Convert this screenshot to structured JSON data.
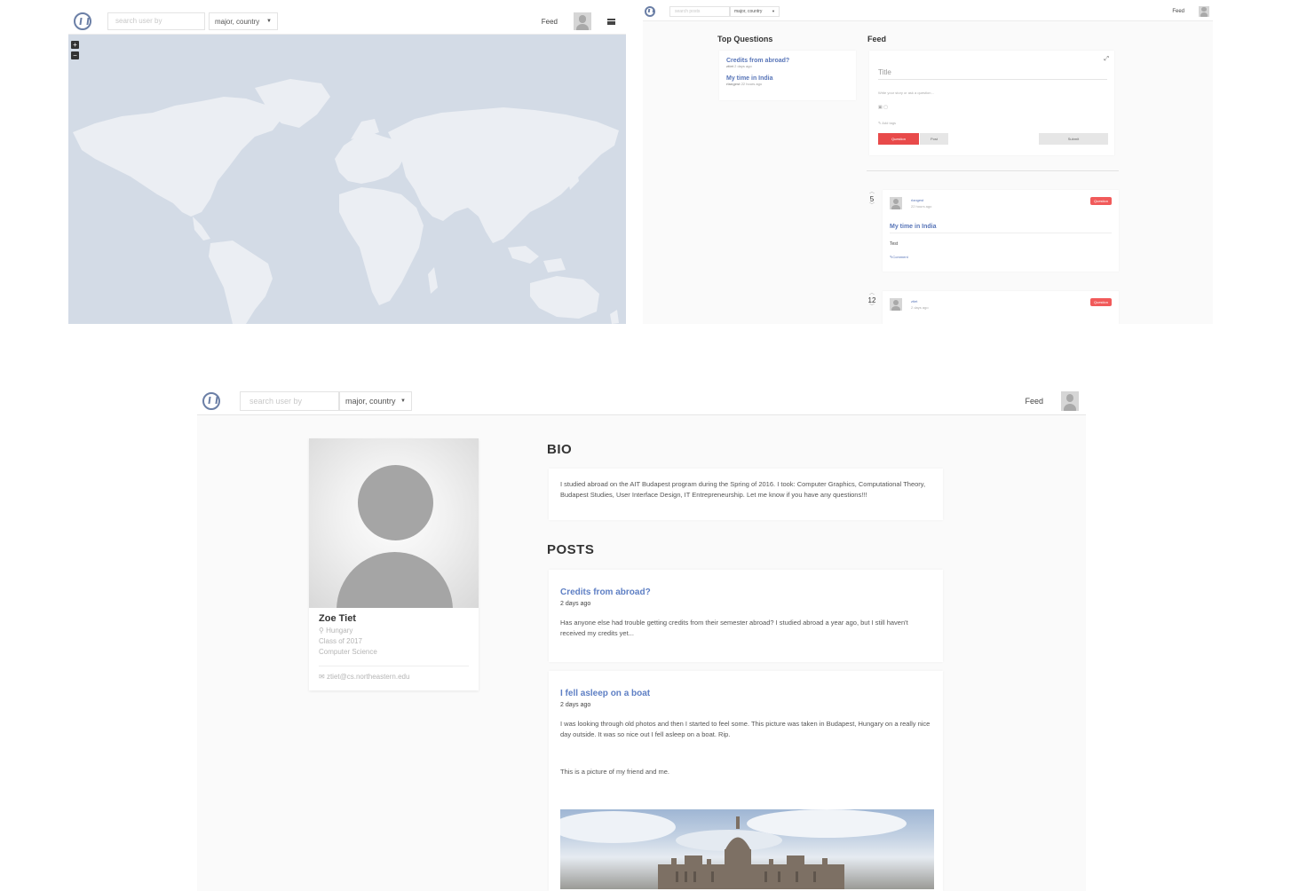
{
  "map_screen": {
    "search_placeholder": "search user by",
    "filter_value": "major, country",
    "feed_link": "Feed",
    "zoom_in": "+",
    "zoom_out": "−"
  },
  "feed_screen": {
    "search_placeholder": "search posts",
    "filter_value": "major, country",
    "feed_link": "Feed",
    "top_questions_heading": "Top Questions",
    "feed_heading": "Feed",
    "top_questions": [
      {
        "title": "Credits from abroad?",
        "author": "ztiet",
        "time": "2 days ago"
      },
      {
        "title": "My time in India",
        "author": "rlangest",
        "time": "22 hours ago"
      }
    ],
    "composer": {
      "title_placeholder": "Title",
      "body_placeholder": "Write your story or ask a question...",
      "tag_placeholder": "Add tags",
      "question_button": "Question",
      "post_button": "Post",
      "submit_button": "Submit"
    },
    "posts": [
      {
        "votes": "5",
        "author": "rlangest",
        "time": "22 hours ago",
        "tag": "Question",
        "title": "My time in India",
        "body": "Test",
        "comment": "Comment"
      },
      {
        "votes": "12",
        "author": "ztiet",
        "time": "2 days ago",
        "tag": "Question"
      }
    ]
  },
  "profile_screen": {
    "search_placeholder": "search user by",
    "filter_value": "major, country",
    "feed_link": "Feed",
    "name": "Zoe Tiet",
    "country": "Hungary",
    "class_year": "Class of 2017",
    "major": "Computer Science",
    "email": "ztiet@cs.northeastern.edu",
    "bio_heading": "BIO",
    "bio_text": "I studied abroad on the AIT Budapest program during the Spring of 2016. I took: Computer Graphics, Computational Theory, Budapest Studies, User Interface Design, IT Entrepreneurship. Let me know if you have any questions!!!",
    "posts_heading": "POSTS",
    "posts": [
      {
        "title": "Credits from abroad?",
        "date": "2 days ago",
        "body": "Has anyone else had trouble getting credits from their semester abroad? I studied abroad a year ago, but I still haven't received my credits yet..."
      },
      {
        "title": "I fell asleep on a boat",
        "date": "2 days ago",
        "body": "I was looking through old photos and then I started to feel some. This picture was taken in Budapest, Hungary on a really nice day outside. It was so nice out I fell asleep on a boat. Rip.",
        "caption": "This is a picture of my friend and me."
      }
    ]
  },
  "colors": {
    "accent_red": "#e84a4a",
    "link_blue": "#5875b8",
    "map_ocean": "#d3dbe6",
    "map_land": "#ebeef3"
  },
  "icons": [
    "logo-icon",
    "chevron-down-icon",
    "user-avatar-icon",
    "hamburger-menu-icon",
    "expand-icon",
    "vote-up-icon",
    "vote-down-icon",
    "location-pin-icon",
    "email-icon",
    "comment-icon",
    "tag-icon"
  ]
}
